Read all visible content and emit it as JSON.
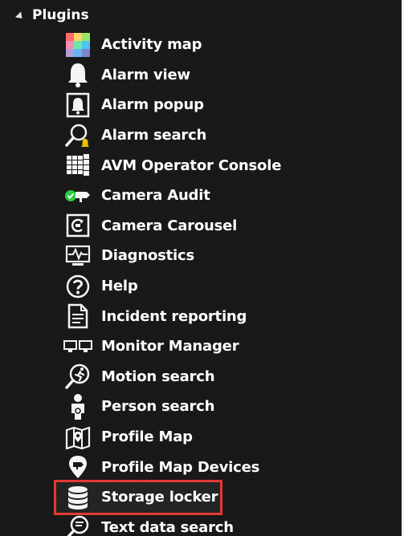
{
  "group": {
    "label": "Plugins",
    "expanded": true
  },
  "plugins": [
    {
      "label": "Activity map",
      "icon": "activity-map-icon"
    },
    {
      "label": "Alarm view",
      "icon": "bell-icon"
    },
    {
      "label": "Alarm popup",
      "icon": "alarm-popup-icon"
    },
    {
      "label": "Alarm search",
      "icon": "alarm-search-icon"
    },
    {
      "label": "AVM Operator Console",
      "icon": "grid-console-icon"
    },
    {
      "label": "Camera Audit",
      "icon": "camera-audit-icon"
    },
    {
      "label": "Camera Carousel",
      "icon": "camera-carousel-icon"
    },
    {
      "label": "Diagnostics",
      "icon": "diagnostics-icon"
    },
    {
      "label": "Help",
      "icon": "help-icon"
    },
    {
      "label": "Incident reporting",
      "icon": "document-icon"
    },
    {
      "label": "Monitor Manager",
      "icon": "monitors-icon"
    },
    {
      "label": "Motion search",
      "icon": "motion-search-icon"
    },
    {
      "label": "Person search",
      "icon": "person-icon"
    },
    {
      "label": "Profile Map",
      "icon": "map-icon"
    },
    {
      "label": "Profile Map Devices",
      "icon": "map-devices-icon"
    },
    {
      "label": "Storage locker",
      "icon": "database-icon",
      "selected": true
    },
    {
      "label": "Text data search",
      "icon": "text-search-icon"
    }
  ],
  "colors": {
    "selection_outline": "#e53935",
    "alarm_accent": "#f2c200",
    "audit_accent": "#2ecc40"
  }
}
